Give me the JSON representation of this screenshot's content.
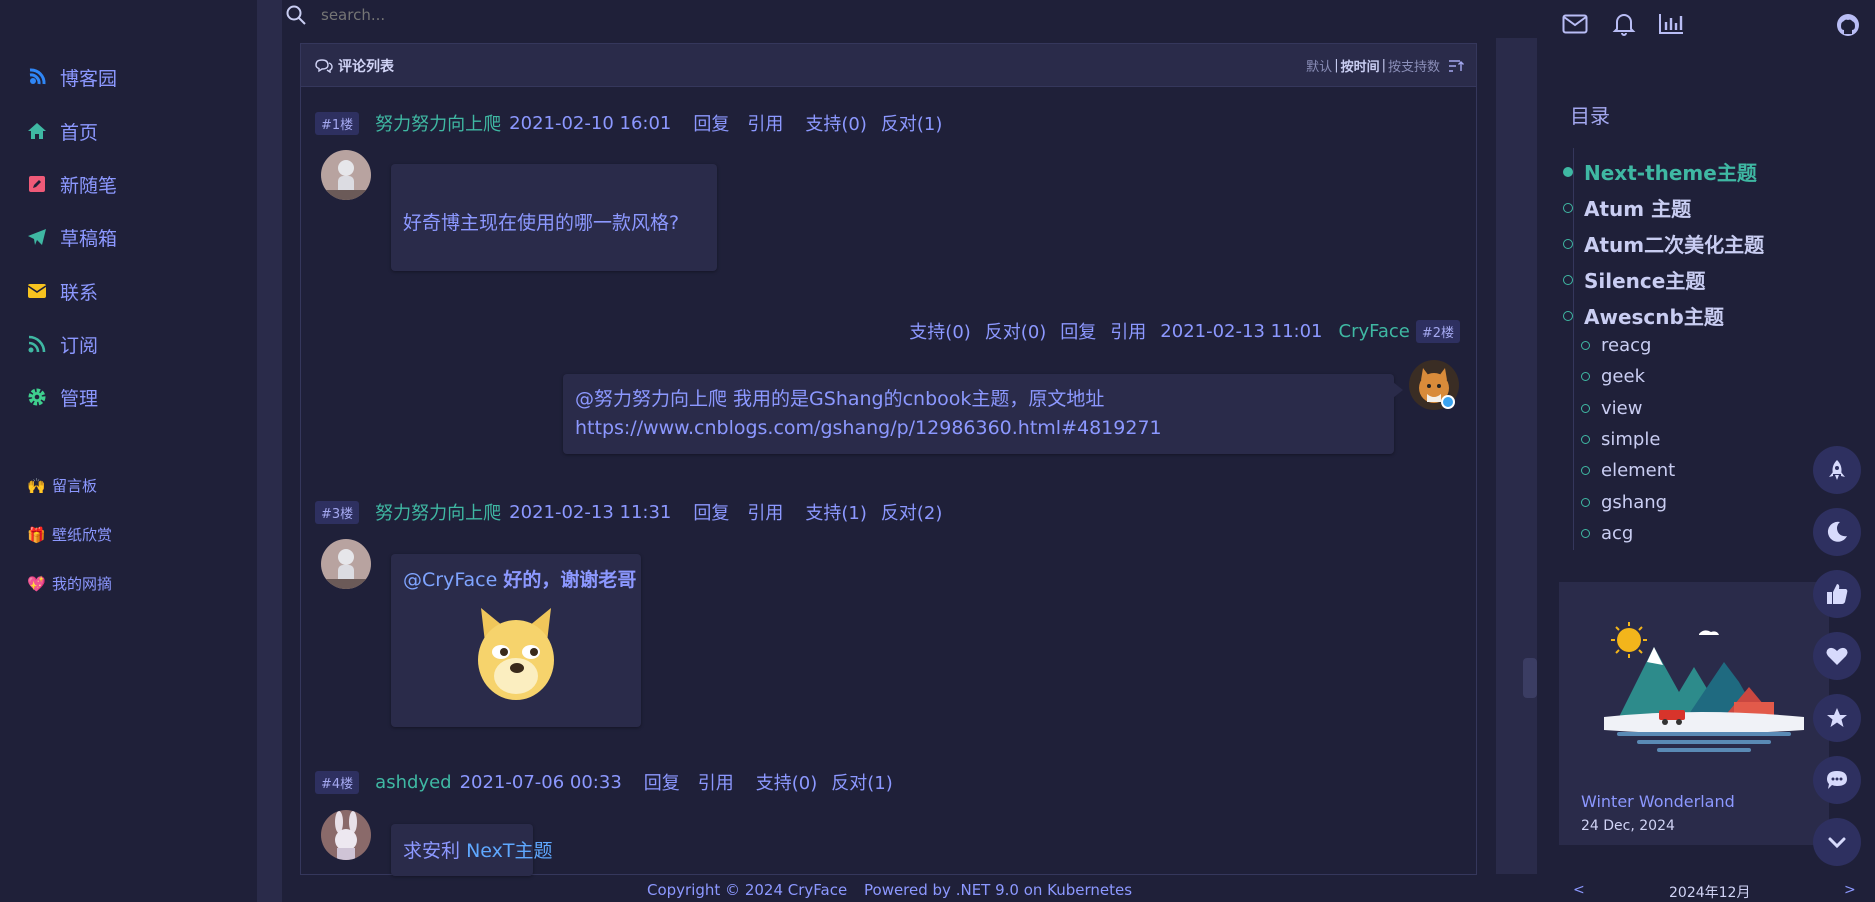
{
  "search": {
    "placeholder": "search..."
  },
  "sidebar": {
    "items": [
      {
        "label": "博客园",
        "icon": "blog-icon",
        "color": "#2f86f6"
      },
      {
        "label": "首页",
        "icon": "home-icon",
        "color": "#3fb8a3"
      },
      {
        "label": "新随笔",
        "icon": "edit-icon",
        "color": "#ef5a78"
      },
      {
        "label": "草稿箱",
        "icon": "paper-plane-icon",
        "color": "#3fb8a3"
      },
      {
        "label": "联系",
        "icon": "envelope-icon",
        "color": "#f7c31f"
      },
      {
        "label": "订阅",
        "icon": "rss-icon",
        "color": "#3fb8a3"
      },
      {
        "label": "管理",
        "icon": "gear-icon",
        "color": "#3fcf8e"
      }
    ],
    "extra": [
      {
        "label": "留言板",
        "icon": "hands-icon",
        "glyph": "🙌"
      },
      {
        "label": "壁纸欣赏",
        "icon": "gift-icon",
        "glyph": "🎁"
      },
      {
        "label": "我的网摘",
        "icon": "heart-icon",
        "glyph": "💖"
      }
    ]
  },
  "comments": {
    "header": "评论列表",
    "sort": {
      "default": "默认",
      "by_time": "按时间",
      "by_support": "按支持数",
      "sep": "|"
    },
    "list": [
      {
        "floor": "#1楼",
        "name": "努力努力向上爬",
        "date": "2021-02-10 16:01",
        "reply": "回复",
        "quote": "引用",
        "support": "支持(0)",
        "oppose": "反对(1)",
        "content": "好奇博主现在使用的哪一款风格?"
      },
      {
        "floor": "#2楼",
        "name": "CryFace",
        "date": "2021-02-13 11:01",
        "reply": "回复",
        "quote": "引用",
        "support": "支持(0)",
        "oppose": "反对(0)",
        "content_line1": "@努力努力向上爬 我用的是GShang的cnbook主题，原文地址",
        "content_line2": "https://www.cnblogs.com/gshang/p/12986360.html#4819271"
      },
      {
        "floor": "#3楼",
        "name": "努力努力向上爬",
        "date": "2021-02-13 11:31",
        "reply": "回复",
        "quote": "引用",
        "support": "支持(1)",
        "oppose": "反对(2)",
        "mention": "@CryFace",
        "content": "好的，谢谢老哥"
      },
      {
        "floor": "#4楼",
        "name": "ashdyed",
        "date": "2021-07-06 00:33",
        "reply": "回复",
        "quote": "引用",
        "support": "支持(0)",
        "oppose": "反对(1)",
        "content_prefix": "求安利",
        "content_link": "NexT主题"
      }
    ]
  },
  "toc": {
    "title": "目录",
    "items": [
      {
        "label": "Next-theme主题",
        "active": true,
        "level": 1
      },
      {
        "label": "Atum 主题",
        "level": 1
      },
      {
        "label": "Atum二次美化主题",
        "level": 1
      },
      {
        "label": "Silence主题",
        "level": 1
      },
      {
        "label": "Awescnb主题",
        "level": 1
      },
      {
        "label": "reacg",
        "level": 2
      },
      {
        "label": "geek",
        "level": 2
      },
      {
        "label": "view",
        "level": 2
      },
      {
        "label": "simple",
        "level": 2
      },
      {
        "label": "element",
        "level": 2
      },
      {
        "label": "gshang",
        "level": 2
      },
      {
        "label": "acg",
        "level": 2
      }
    ]
  },
  "topicons": [
    "mail-icon",
    "bell-icon",
    "chart-icon",
    "github-icon"
  ],
  "card": {
    "title": "Winter Wonderland",
    "date": "24 Dec, 2024"
  },
  "calendar": {
    "prev": "<",
    "month": "2024年12月",
    "next": ">"
  },
  "fabs": [
    "rocket-icon",
    "moon-icon",
    "thumbs-up-icon",
    "heart-icon",
    "star-icon",
    "chat-icon",
    "chevron-down-icon"
  ],
  "footer": {
    "copyright": "Copyright © 2024 CryFace",
    "powered": "Powered by .NET 9.0 on Kubernetes"
  },
  "colors": {
    "bg": "#1f2039",
    "panel": "#2a2b4a",
    "accent": "#8c98ff",
    "teal": "#3fb8a3"
  }
}
